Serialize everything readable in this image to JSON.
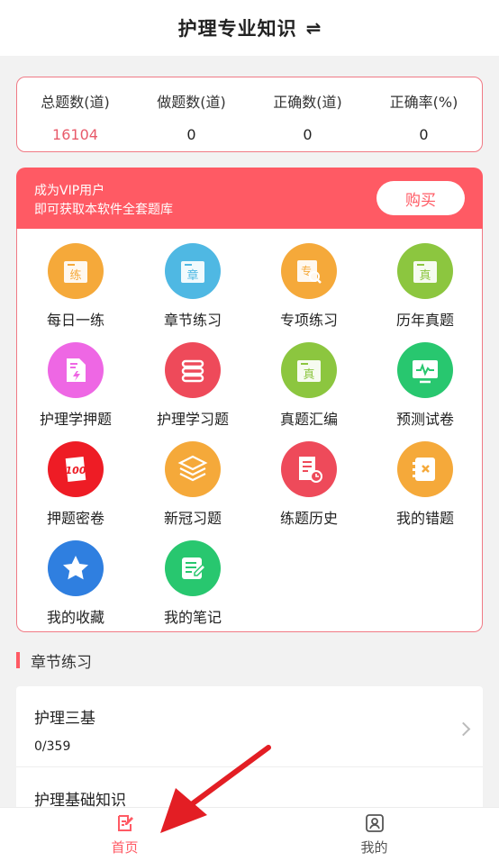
{
  "header": {
    "title": "护理专业知识",
    "swap_icon": "swap-icon"
  },
  "stats": [
    {
      "label": "总题数(道)",
      "value": "16104",
      "highlight": true
    },
    {
      "label": "做题数(道)",
      "value": "0"
    },
    {
      "label": "正确数(道)",
      "value": "0"
    },
    {
      "label": "正确率(%)",
      "value": "0"
    }
  ],
  "vip": {
    "line1": "成为VIP用户",
    "line2": "即可获取本软件全套题库",
    "buy_label": "购买"
  },
  "features": [
    {
      "label": "每日一练",
      "icon": "daily-practice-icon",
      "color": "#f5a93a",
      "glyph": "练"
    },
    {
      "label": "章节练习",
      "icon": "chapter-practice-icon",
      "color": "#4fb8e3",
      "glyph": "章"
    },
    {
      "label": "专项练习",
      "icon": "special-practice-icon",
      "color": "#f5a93a",
      "glyph": "专"
    },
    {
      "label": "历年真题",
      "icon": "past-exams-icon",
      "color": "#8cc63f",
      "glyph": "真"
    },
    {
      "label": "护理学押题",
      "icon": "predicted-questions-icon",
      "color": "#ee67e4",
      "glyph": ""
    },
    {
      "label": "护理学习题",
      "icon": "exercises-icon",
      "color": "#ee4a5a",
      "glyph": ""
    },
    {
      "label": "真题汇编",
      "icon": "exam-collection-icon",
      "color": "#8cc63f",
      "glyph": "真"
    },
    {
      "label": "预测试卷",
      "icon": "mock-exam-icon",
      "color": "#28c76f",
      "glyph": ""
    },
    {
      "label": "押题密卷",
      "icon": "secret-paper-icon",
      "color": "#ee1c25",
      "glyph": "100"
    },
    {
      "label": "新冠习题",
      "icon": "covid-exercises-icon",
      "color": "#f5a93a",
      "glyph": ""
    },
    {
      "label": "练题历史",
      "icon": "practice-history-icon",
      "color": "#ee4a5a",
      "glyph": ""
    },
    {
      "label": "我的错题",
      "icon": "wrong-questions-icon",
      "color": "#f5a93a",
      "glyph": ""
    },
    {
      "label": "我的收藏",
      "icon": "favorites-icon",
      "color": "#2f7fe0",
      "glyph": ""
    },
    {
      "label": "我的笔记",
      "icon": "notes-icon",
      "color": "#28c76f",
      "glyph": ""
    }
  ],
  "section": {
    "title": "章节练习"
  },
  "chapters": [
    {
      "name": "护理三基",
      "progress": "0/359"
    },
    {
      "name": "护理基础知识"
    }
  ],
  "tabbar": [
    {
      "label": "首页",
      "icon": "home-edit-icon",
      "active": true,
      "active_color": "#ff5a64"
    },
    {
      "label": "我的",
      "icon": "profile-icon",
      "active": false
    }
  ]
}
